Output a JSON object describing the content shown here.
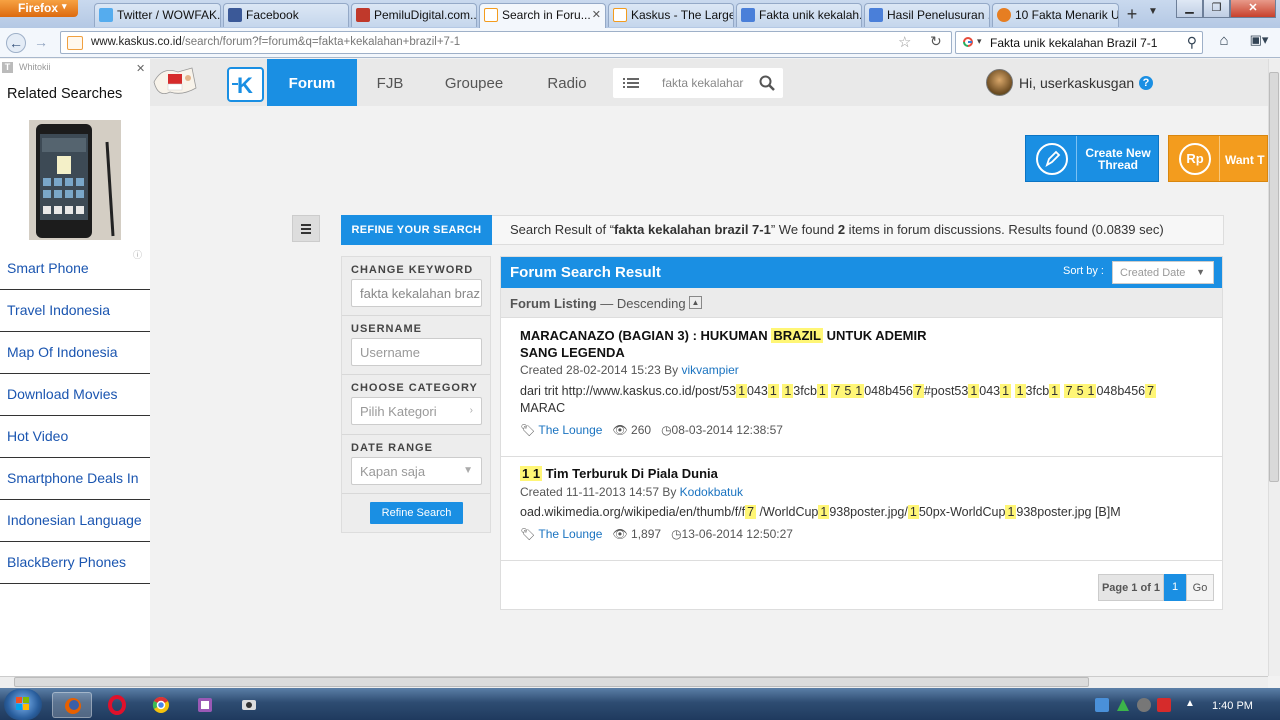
{
  "browser": {
    "firefox_label": "Firefox",
    "tabs": [
      {
        "label": "Twitter / WOWFAK...",
        "icon": "twitter-icon",
        "color": "#55acee"
      },
      {
        "label": "Facebook",
        "icon": "facebook-icon",
        "color": "#3b5998"
      },
      {
        "label": "PemiluDigital.com...",
        "icon": "pemilu-icon",
        "color": "#c0392b"
      },
      {
        "label": "Search in Foru...",
        "icon": "kaskus-icon",
        "color": "#f39c1e",
        "active": true
      },
      {
        "label": "Kaskus - The Large...",
        "icon": "kaskus-icon",
        "color": "#f39c1e"
      },
      {
        "label": "Fakta unik kekalah...",
        "icon": "google-icon",
        "color": "#4a7fd9"
      },
      {
        "label": "Hasil Penelusuran ...",
        "icon": "google-icon",
        "color": "#4a7fd9"
      },
      {
        "label": "10 Fakta Menarik U...",
        "icon": "site-icon",
        "color": "#e67e22"
      }
    ],
    "url_domain": "www.kaskus.co.id",
    "url_path": "/search/forum?f=forum&q=fakta+kekalahan+brazil+7-1",
    "search_text": "Fakta unik kekalahan Brazil 7-1"
  },
  "ad_panel": {
    "brand": "Whitokii",
    "heading": "Related Searches",
    "items": [
      "Smart Phone",
      "Travel Indonesia",
      "Map Of Indonesia",
      "Download Movies",
      "Hot Video",
      "Smartphone Deals In",
      "Indonesian Language",
      "BlackBerry Phones"
    ]
  },
  "kaskus": {
    "nav": [
      "Forum",
      "FJB",
      "Groupee",
      "Radio"
    ],
    "search_value": "fakta kekalahar",
    "greeting": "Hi, userkaskusgan",
    "create_thread": "Create New Thread",
    "want_label": "Want T",
    "want_icon_text": "Rp"
  },
  "refine": {
    "tab": "REFINE YOUR SEARCH",
    "summary_prefix": "Search Result of “",
    "query": "fakta kekalahan brazil 7-1",
    "summary_mid": "” We found ",
    "count": "2",
    "summary_suffix": " items in forum discussions. Results found (0.0839 sec)"
  },
  "filters": {
    "keyword_label": "CHANGE KEYWORD",
    "keyword_value": "fakta kekalahan braz",
    "username_label": "USERNAME",
    "username_placeholder": "Username",
    "category_label": "CHOOSE CATEGORY",
    "category_placeholder": "Pilih Kategori",
    "date_label": "DATE RANGE",
    "date_placeholder": "Kapan saja",
    "button": "Refine Search"
  },
  "results": {
    "title": "Forum Search Result",
    "sort_label": "Sort by :",
    "sort_value": "Created Date",
    "listing_label": "Forum Listing",
    "listing_order": " — Descending",
    "items": [
      {
        "title_a": "MARACANAZO (BAGIAN 3) : HUKUMAN ",
        "title_hl": "BRAZIL",
        "title_b": " UNTUK ADEMIR",
        "title_c": "SANG LEGENDA",
        "created": "Created 28-02-2014 15:23 By ",
        "user": "vikvampier",
        "snippet_parts": [
          "dari trit http://www.kaskus.co.id/post/53",
          "1",
          "043",
          "1",
          " ",
          "1",
          "3fcb",
          "1",
          " ",
          "7",
          "5",
          "1",
          "048b456",
          "7",
          "#post53",
          "1",
          "043",
          "1",
          " ",
          "1",
          "3fcb",
          "1",
          " ",
          "7",
          "5",
          "1",
          "048b456",
          "7"
        ],
        "snippet_line2": "MARAC",
        "category": "The Lounge",
        "views": "260",
        "last": "08-03-2014 12:38:57"
      },
      {
        "title_hl": "1 1",
        "title_b": " Tim Terburuk Di Piala Dunia",
        "created": "Created 11-11-2013 14:57 By ",
        "user": "Kodokbatuk",
        "snippet_parts": [
          "oad.wikimedia.org/wikipedia/en/thumb/f/f",
          "7",
          " /WorldCup",
          "1",
          "938poster.jpg/",
          "1",
          "50px-WorldCup",
          "1",
          "938poster.jpg [B]M"
        ],
        "category": "The Lounge",
        "views": "1,897",
        "last": "13-06-2014 12:50:27"
      }
    ],
    "page_label": "Page 1 of 1",
    "current_page": "1",
    "go_label": "Go"
  },
  "taskbar": {
    "clock": "1:40 PM"
  },
  "colors": {
    "kaskus_blue": "#1a8fe3",
    "kaskus_orange": "#f39c1e",
    "highlight": "#fff676",
    "link_blue": "#1a73c0"
  }
}
